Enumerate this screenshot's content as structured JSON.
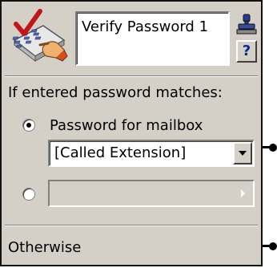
{
  "node": {
    "name": "Verify Password 1",
    "icon": "verify-password-icon",
    "help_label": "?",
    "stamp_icon": "stamp-icon"
  },
  "condition": {
    "heading": "If entered password matches:",
    "option1_label": "Password for mailbox",
    "option1_selected": true,
    "option1_value": "[Called Extension]",
    "option2_selected": false,
    "option2_value": ""
  },
  "otherwise_label": "Otherwise",
  "colors": {
    "panel_bg": "#d4d0c8",
    "field_bg": "#ffffff",
    "help_color": "#0a2a8a"
  }
}
